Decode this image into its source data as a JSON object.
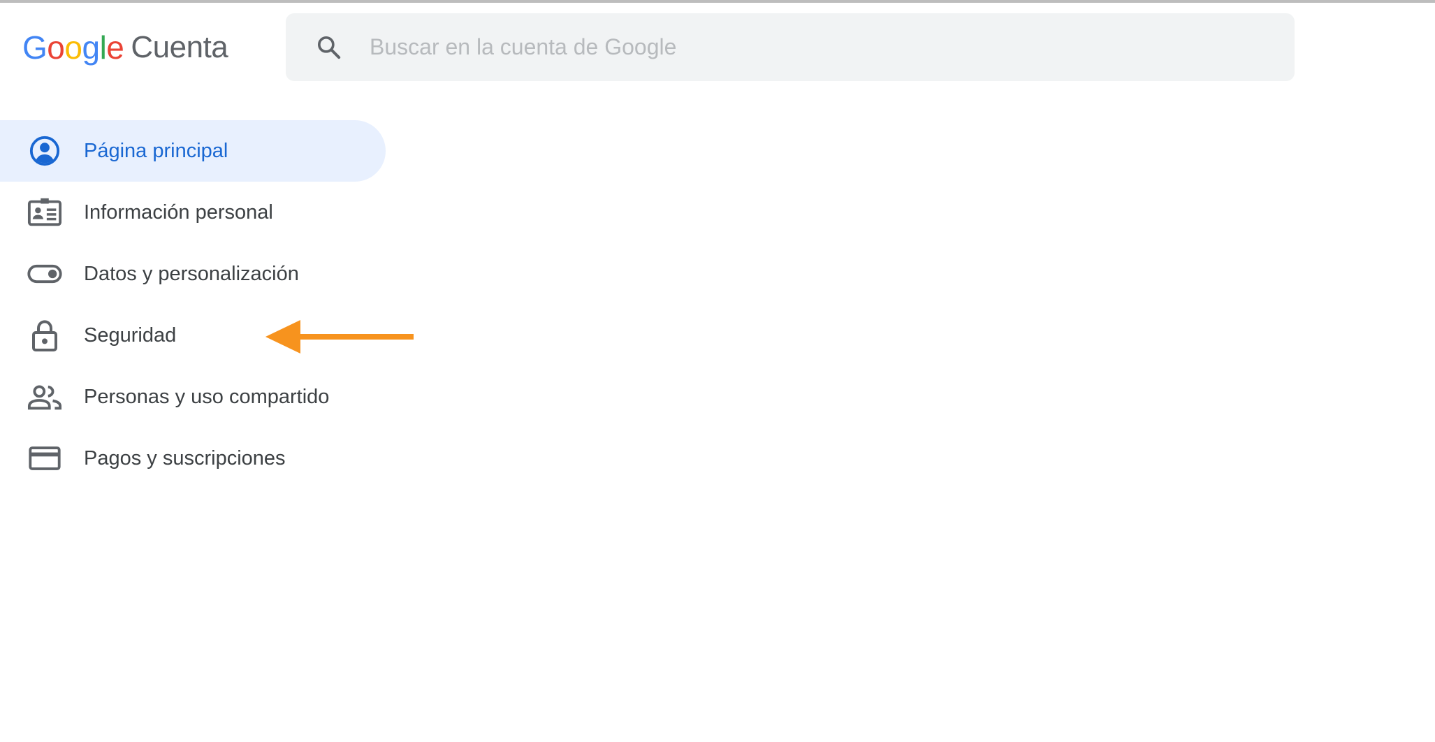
{
  "app": {
    "logo_letters": [
      {
        "char": "G",
        "color": "#4285F4"
      },
      {
        "char": "o",
        "color": "#EA4335"
      },
      {
        "char": "o",
        "color": "#FBBC05"
      },
      {
        "char": "g",
        "color": "#4285F4"
      },
      {
        "char": "l",
        "color": "#34A853"
      },
      {
        "char": "e",
        "color": "#EA4335"
      }
    ],
    "product_name": "Cuenta"
  },
  "search": {
    "placeholder": "Buscar en la cuenta de Google",
    "value": "",
    "icon": "search-icon"
  },
  "sidebar": {
    "items": [
      {
        "label": "Página principal",
        "icon": "account-circle-icon",
        "active": true
      },
      {
        "label": "Información personal",
        "icon": "id-card-icon",
        "active": false
      },
      {
        "label": "Datos y personalización",
        "icon": "toggle-icon",
        "active": false
      },
      {
        "label": "Seguridad",
        "icon": "lock-icon",
        "active": false
      },
      {
        "label": "Personas y uso compartido",
        "icon": "people-icon",
        "active": false
      },
      {
        "label": "Pagos y suscripciones",
        "icon": "credit-card-icon",
        "active": false
      }
    ]
  },
  "colors": {
    "accent": "#1967d2",
    "active_background": "#e8f0fe",
    "search_background": "#f1f3f4",
    "annotation_arrow": "#f7931e"
  }
}
